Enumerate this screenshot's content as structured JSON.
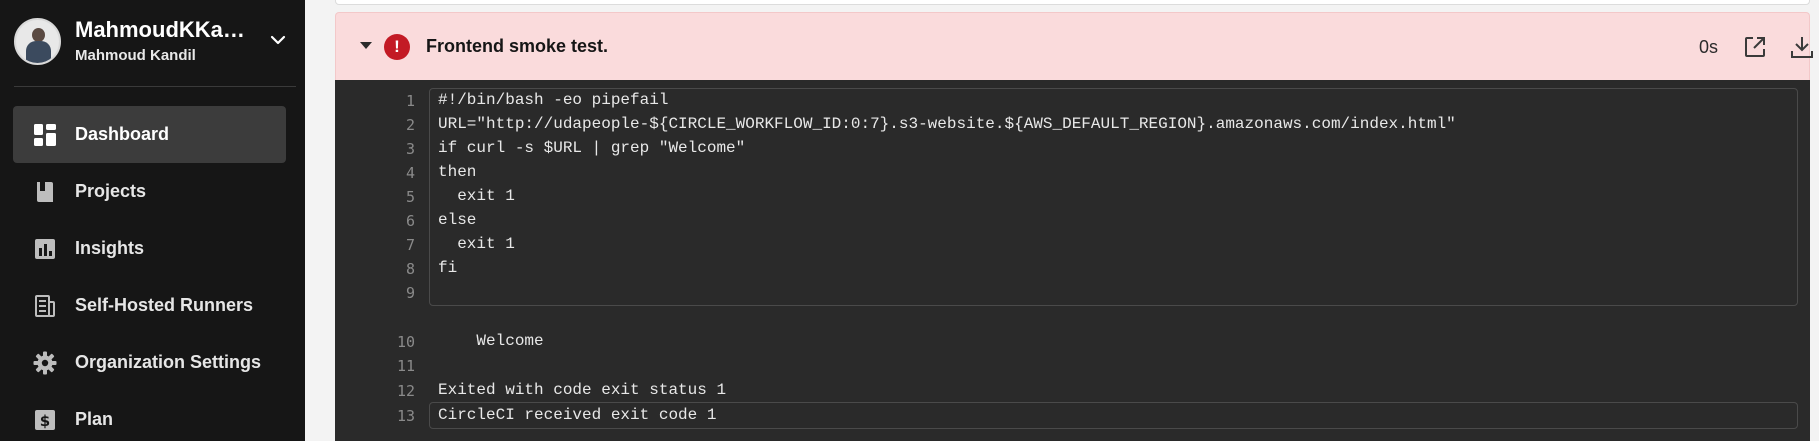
{
  "sidebar": {
    "org": {
      "name": "MahmoudKKa…",
      "user": "Mahmoud Kandil"
    },
    "items": [
      {
        "label": "Dashboard",
        "icon": "dashboard-icon",
        "active": true
      },
      {
        "label": "Projects",
        "icon": "projects-icon",
        "active": false
      },
      {
        "label": "Insights",
        "icon": "insights-icon",
        "active": false
      },
      {
        "label": "Self-Hosted Runners",
        "icon": "runners-icon",
        "active": false
      },
      {
        "label": "Organization Settings",
        "icon": "gear-icon",
        "active": false
      },
      {
        "label": "Plan",
        "icon": "dollar-icon",
        "active": false
      }
    ]
  },
  "step": {
    "title": "Frontend smoke test.",
    "status": "failed",
    "status_color": "#c31a25",
    "duration": "0s"
  },
  "log": {
    "lines": [
      {
        "n": "1",
        "text": "#!/bin/bash -eo pipefail"
      },
      {
        "n": "2",
        "text": "URL=\"http://udapeople-${CIRCLE_WORKFLOW_ID:0:7}.s3-website.${AWS_DEFAULT_REGION}.amazonaws.com/index.html\""
      },
      {
        "n": "3",
        "text": "if curl -s $URL | grep \"Welcome\""
      },
      {
        "n": "4",
        "text": "then"
      },
      {
        "n": "5",
        "text": "  exit 1"
      },
      {
        "n": "6",
        "text": "else"
      },
      {
        "n": "7",
        "text": "  exit 1"
      },
      {
        "n": "8",
        "text": "fi"
      },
      {
        "n": "9",
        "text": ""
      },
      {
        "n": "10",
        "text": "    Welcome"
      },
      {
        "n": "11",
        "text": ""
      },
      {
        "n": "12",
        "text": "Exited with code exit status 1"
      },
      {
        "n": "13",
        "text": "CircleCI received exit code 1"
      }
    ]
  }
}
